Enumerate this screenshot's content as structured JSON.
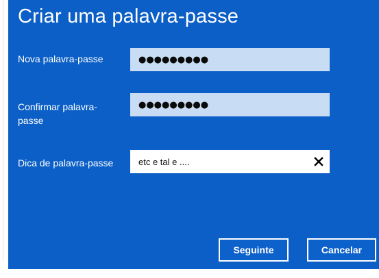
{
  "dialog": {
    "title": "Criar uma palavra-passe"
  },
  "fields": {
    "new_password": {
      "label": "Nova palavra-passe",
      "masked_value": "●●●●●●●●●"
    },
    "confirm_password": {
      "label": "Confirmar palavra-passe",
      "masked_value": "●●●●●●●●●"
    },
    "hint": {
      "label": "Dica de palavra-passe",
      "value": "etc e tal e ...."
    }
  },
  "buttons": {
    "next_label": "Seguinte",
    "cancel_label": "Cancelar"
  },
  "icons": {
    "clear": "close-icon"
  },
  "colors": {
    "dialog_background": "#0c5fc6",
    "password_field_background": "#c8ddf3",
    "hint_field_background": "#ffffff",
    "button_border": "#ffffff"
  }
}
